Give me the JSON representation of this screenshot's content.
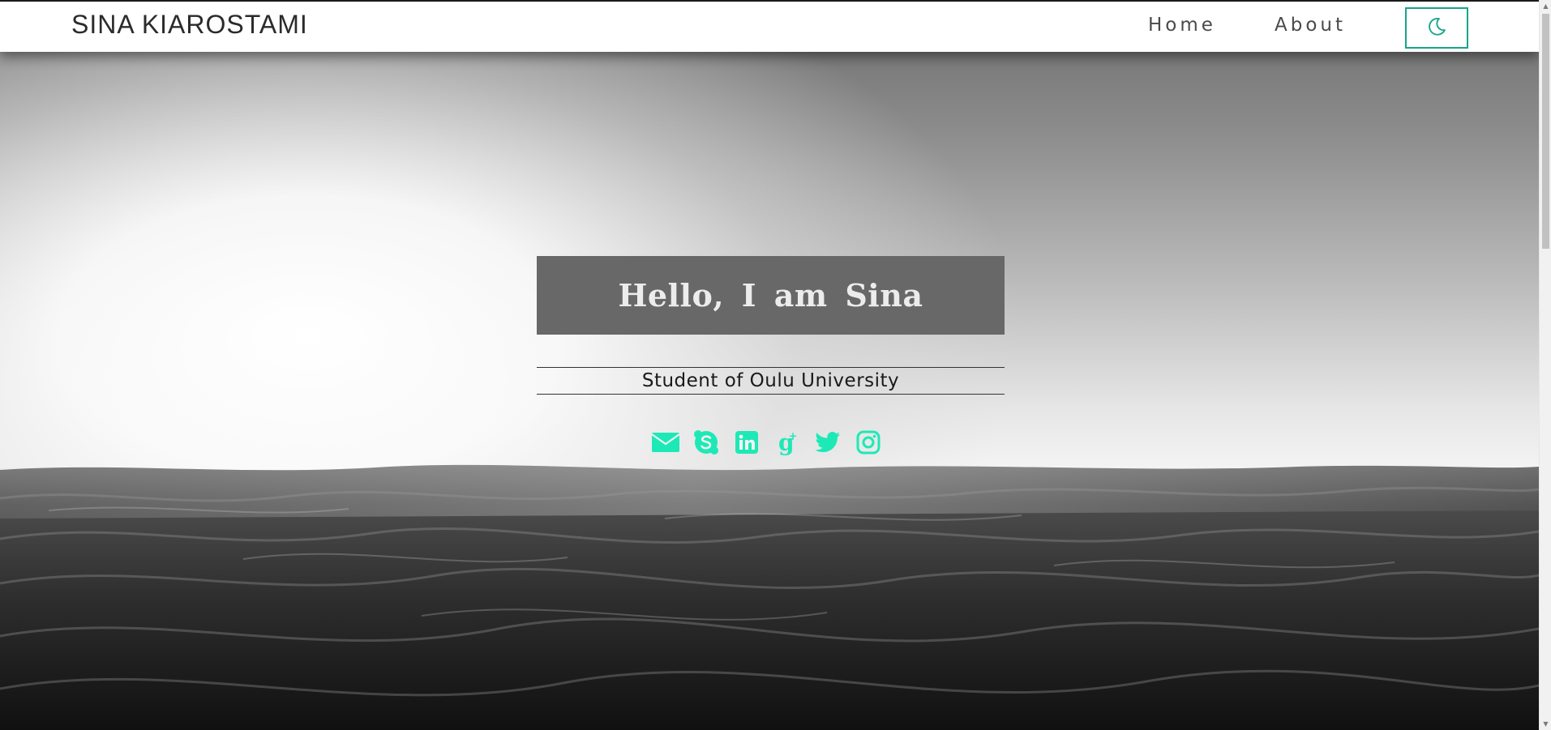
{
  "navbar": {
    "brand": "SINA KIAROSTAMI",
    "links": [
      {
        "label": "Home"
      },
      {
        "label": "About"
      }
    ],
    "theme_toggle_icon": "moon-icon"
  },
  "hero": {
    "title": "Hello, I am Sina",
    "subtitle": "Student of Oulu University",
    "background": "grayscale-ocean-horizon",
    "social_icons": [
      "envelope-icon",
      "skype-icon",
      "linkedin-icon",
      "google-plus-icon",
      "twitter-icon",
      "instagram-icon"
    ]
  },
  "colors": {
    "accent": "#1de9b6",
    "toggle_border": "#17a589",
    "title_box": "#686868",
    "title_text": "#ececec"
  },
  "scrollbar": {
    "up": "▲",
    "down": "▼"
  }
}
